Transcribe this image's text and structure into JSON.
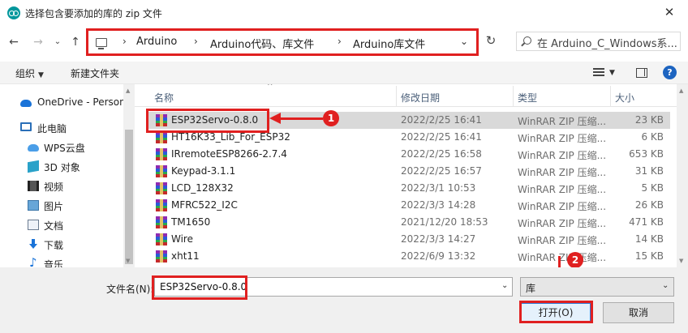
{
  "window": {
    "title": "选择包含要添加的库的 zip 文件",
    "close_glyph": "✕"
  },
  "nav": {
    "back_glyph": "←",
    "forward_glyph": "→",
    "dropdown_glyph": "⌄",
    "up_glyph": "↑",
    "breadcrumbs": [
      "Arduino",
      "Arduino代码、库文件",
      "Arduino库文件"
    ],
    "breadcrumb_sep": "›",
    "address_dropdown_glyph": "⌄",
    "refresh_glyph": "↻",
    "search_placeholder": "在 Arduino_C_Windows系..."
  },
  "toolbar": {
    "organize": "组织",
    "new_folder": "新建文件夹",
    "caret": "▼",
    "help": "?"
  },
  "sidebar": {
    "items": [
      {
        "label": "OneDrive - Person",
        "icon": "onedrive-icon"
      },
      {
        "label": "此电脑",
        "icon": "this-pc-icon"
      },
      {
        "label": "WPS云盘",
        "icon": "wps-cloud-icon"
      },
      {
        "label": "3D 对象",
        "icon": "3d-objects-icon"
      },
      {
        "label": "视频",
        "icon": "video-icon"
      },
      {
        "label": "图片",
        "icon": "pictures-icon"
      },
      {
        "label": "文档",
        "icon": "documents-icon"
      },
      {
        "label": "下载",
        "icon": "downloads-icon"
      },
      {
        "label": "音乐",
        "icon": "music-icon"
      }
    ],
    "scroll_up": "▲",
    "scroll_down": "▼"
  },
  "filelist": {
    "columns": {
      "name": "名称",
      "date": "修改日期",
      "type": "类型",
      "size": "大小"
    },
    "sort_glyph": "^",
    "rows": [
      {
        "name": "ESP32Servo-0.8.0",
        "date": "2022/2/25 16:41",
        "type": "WinRAR ZIP 压缩...",
        "size": "23 KB",
        "selected": true
      },
      {
        "name": "HT16K33_Lib_For_ESP32",
        "date": "2022/2/25 16:41",
        "type": "WinRAR ZIP 压缩...",
        "size": "6 KB"
      },
      {
        "name": "IRremoteESP8266-2.7.4",
        "date": "2022/2/25 16:58",
        "type": "WinRAR ZIP 压缩...",
        "size": "653 KB"
      },
      {
        "name": "Keypad-3.1.1",
        "date": "2022/2/25 16:57",
        "type": "WinRAR ZIP 压缩...",
        "size": "31 KB"
      },
      {
        "name": "LCD_128X32",
        "date": "2022/3/1 10:53",
        "type": "WinRAR ZIP 压缩...",
        "size": "5 KB"
      },
      {
        "name": "MFRC522_I2C",
        "date": "2022/3/3 14:28",
        "type": "WinRAR ZIP 压缩...",
        "size": "26 KB"
      },
      {
        "name": "TM1650",
        "date": "2021/12/20 18:53",
        "type": "WinRAR ZIP 压缩...",
        "size": "471 KB"
      },
      {
        "name": "Wire",
        "date": "2022/3/3 14:27",
        "type": "WinRAR ZIP 压缩...",
        "size": "14 KB"
      },
      {
        "name": "xht11",
        "date": "2022/6/9 13:32",
        "type": "WinRAR ZIP 压缩...",
        "size": "15 KB"
      }
    ],
    "scroll_up": "▲",
    "scroll_down": "▼"
  },
  "annotations": {
    "badge1": "1",
    "badge2": "2"
  },
  "footer": {
    "filename_label": "文件名(N):",
    "filename_value": "ESP32Servo-0.8.0",
    "filter_value": "库",
    "dropdown_glyph": "⌄",
    "open_button": "打开(O)",
    "cancel_button": "取消"
  },
  "colors": {
    "highlight_red": "#e02020",
    "selection_gray": "#d9d9d9",
    "accent_blue": "#2e7bd6"
  }
}
